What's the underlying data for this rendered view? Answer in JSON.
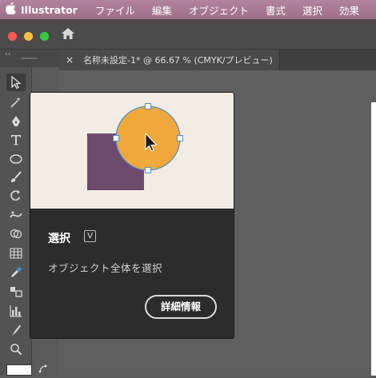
{
  "menubar": {
    "apple_icon": "apple-logo-icon",
    "app_name": "Illustrator",
    "items": [
      "ファイル",
      "編集",
      "オブジェクト",
      "書式",
      "選択",
      "効果"
    ]
  },
  "window": {
    "traffic_lights": [
      {
        "name": "close",
        "color": "#fc5753"
      },
      {
        "name": "minimize",
        "color": "#fdbc40"
      },
      {
        "name": "zoom",
        "color": "#33c748"
      }
    ],
    "home_icon": "home-icon"
  },
  "tools_panel": {
    "collapse_glyph": "‹‹",
    "tools": [
      {
        "name": "selection-tool",
        "icon": "arrow-pointer-icon"
      },
      {
        "name": "magic-wand-tool",
        "icon": "magic-wand-icon"
      },
      {
        "name": "pen-tool",
        "icon": "pen-icon"
      },
      {
        "name": "type-tool",
        "icon": "type-icon"
      },
      {
        "name": "ellipse-tool",
        "icon": "ellipse-icon"
      },
      {
        "name": "paintbrush-tool",
        "icon": "brush-icon"
      },
      {
        "name": "rotate-tool",
        "icon": "rotate-icon"
      },
      {
        "name": "width-tool",
        "icon": "width-icon"
      },
      {
        "name": "shape-builder-tool",
        "icon": "shape-builder-icon"
      },
      {
        "name": "perspective-grid-tool",
        "icon": "grid-icon"
      },
      {
        "name": "eyedropper-tool",
        "icon": "eyedropper-icon"
      },
      {
        "name": "blend-tool",
        "icon": "blend-icon"
      },
      {
        "name": "graph-tool",
        "icon": "bar-graph-icon"
      },
      {
        "name": "slice-tool",
        "icon": "slice-icon"
      },
      {
        "name": "zoom-tool",
        "icon": "magnifier-icon"
      }
    ]
  },
  "document_tab": {
    "close_glyph": "×",
    "title": "名称未設定-1* @ 66.67 % (CMYK/プレビュー)"
  },
  "tooltip": {
    "title": "選択",
    "shortcut": "V",
    "description": "オブジェクト全体を選択",
    "more_button": "詳細情報",
    "illustration": {
      "background": "#f3ece4",
      "square_color": "#6e4a6e",
      "circle_color": "#f0a83a",
      "selection_color": "#4a90d9"
    }
  }
}
